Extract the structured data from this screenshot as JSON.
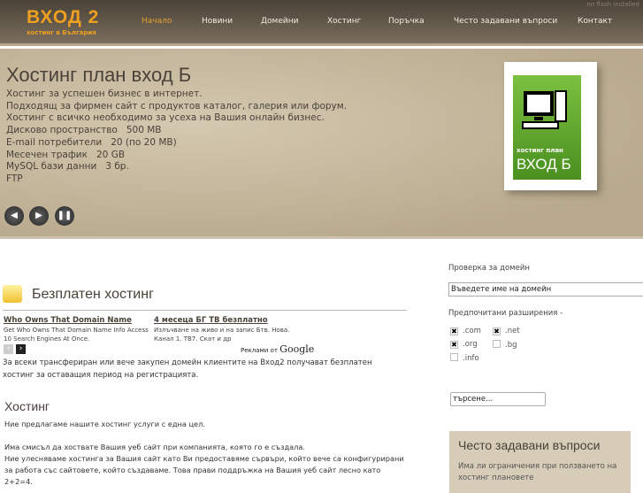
{
  "header": {
    "logo_title": "ВХОД 2",
    "logo_subtitle": "хостинг в България",
    "no_flash": "no flash installed",
    "nav": [
      "Начало",
      "Новини",
      "Домейни",
      "Хостинг",
      "Поръчка",
      "Често задавани въпроси",
      "Контакт"
    ]
  },
  "hero": {
    "title": "Хостинг план вход Б",
    "lines": [
      "Хостинг за успешен бизнес в интернет.",
      "Подходящ за фирмен сайт с продуктов каталог, галерия или форум.",
      "Хостинг с всичко необходимо за усеха на Вашия онлайн бизнес.",
      "Дисково пространство   500 MB",
      "E-mail потребители   20 (по 20 MB)",
      "Месечен трафик   20 GB",
      "MySQL бази данни   3 бр.",
      "FTP"
    ],
    "box_line1": "хостинг план",
    "box_line2": "ВХОД Б",
    "controls": [
      "prev",
      "next",
      "pause"
    ]
  },
  "free_hosting": {
    "title": "Безплатен хостинг",
    "ads": [
      {
        "title": "Who Owns That Domain Name",
        "text": "Get Who Owns That Domain Name Info Access 10 Search Engines At Once."
      },
      {
        "title": "4 месеца БГ ТВ безплатно",
        "text": "Излъчване на живо и на запис Бтв. Нова. Канал 1. ТВ7. Скат и др"
      }
    ],
    "ads_by": "Реклами от",
    "ads_brand": "Google",
    "text": "За всеки трансфериран или вече закупен домейн клиентите на Вход2 получават безплатен хостинг за оставащия период на регистрацията."
  },
  "hosting": {
    "title": "Хостинг",
    "p1": "Ние предлагаме нашите хостинг услуги с една цел.",
    "p2": "Има смисъл да хоствате Вашия уеб сайт при компанията, която го е създала.",
    "p3": "Ние улесняваме хостинга за Вашия сайт като Ви предоставяме сървъри, който вече са конфигурирани за работа със сайтовете, който създаваме. Това прави поддръжка на Вашия уеб сайт лесно като 2+2=4."
  },
  "sidebar": {
    "domain_label": "Проверка за домейн",
    "domain_value": "Въведете име на домейн",
    "ext_label": "Предпочитани разширения -",
    "extensions": [
      {
        "label": ".com",
        "checked": true
      },
      {
        "label": ".net",
        "checked": true
      },
      {
        "label": ".org",
        "checked": true
      },
      {
        "label": ".bg",
        "checked": false
      },
      {
        "label": ".info",
        "checked": false
      }
    ],
    "search_value": "търсене...",
    "faq_title": "Често задавани въпроси",
    "faq_question": "Има ли ограничения при ползването на хостинг плановете"
  }
}
